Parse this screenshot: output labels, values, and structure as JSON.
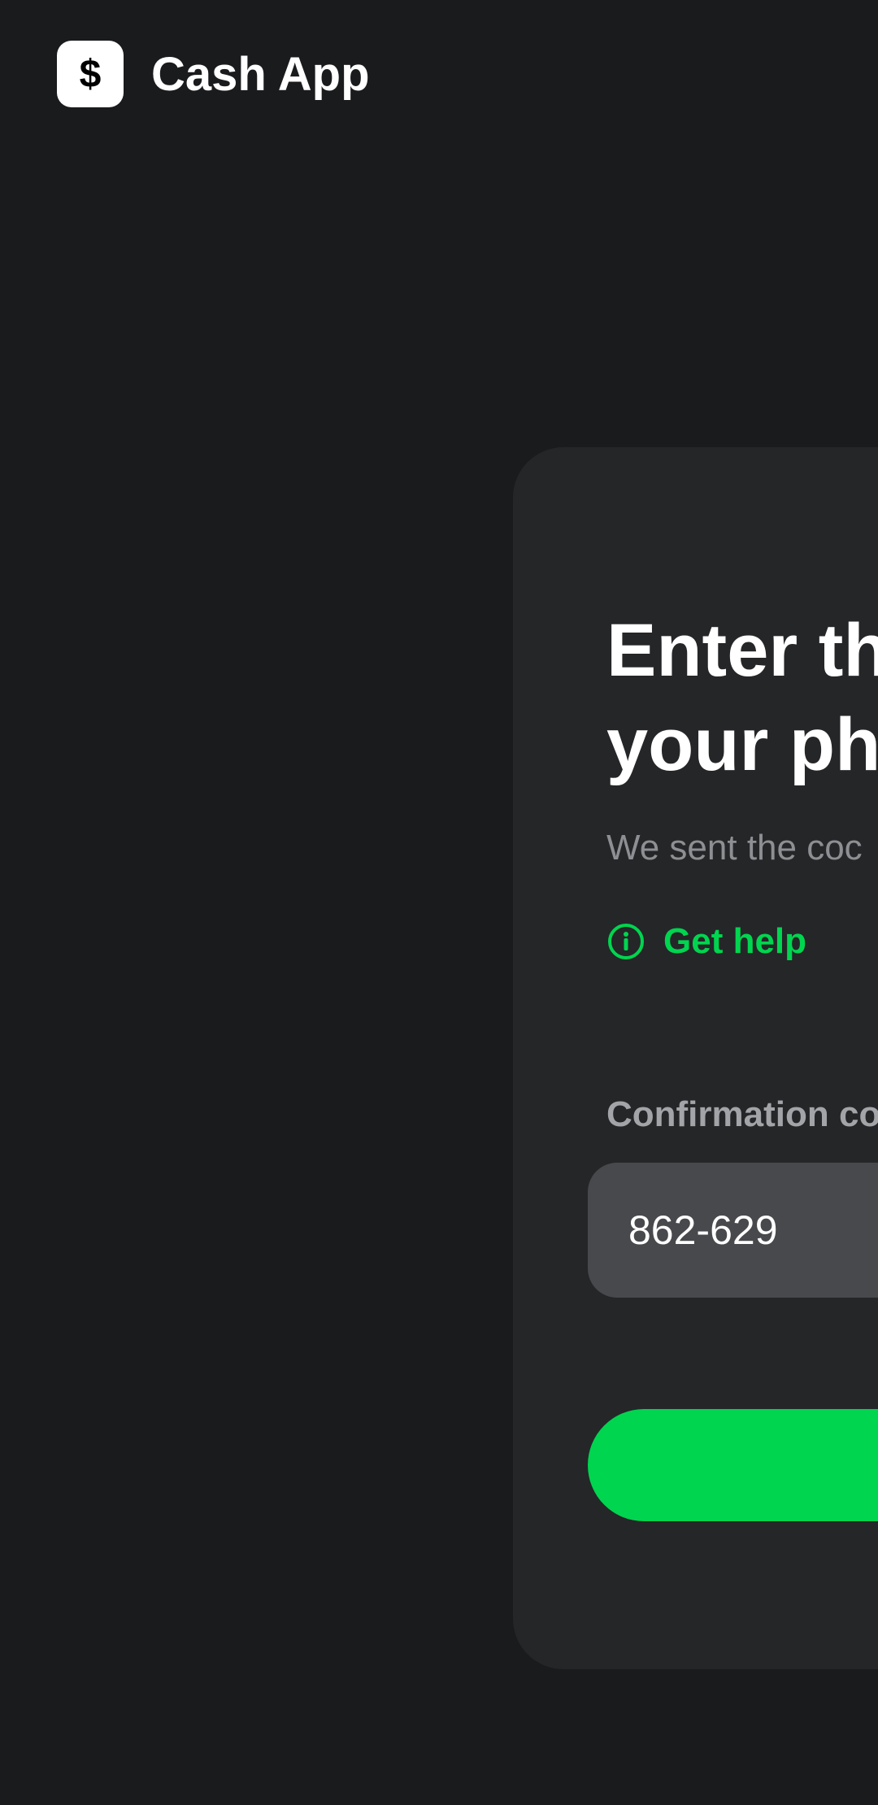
{
  "header": {
    "logo_icon": "dollar-sign-icon",
    "brand_name": "Cash App"
  },
  "card": {
    "title_line1": "Enter th",
    "title_line2": "your ph",
    "subtitle": "We sent the coc",
    "help_icon": "info-circle-icon",
    "help_label": "Get help",
    "field_label": "Confirmation co",
    "field_value": "862-629"
  },
  "colors": {
    "background": "#1a1b1d",
    "card": "#252628",
    "accent_green": "#00d54f",
    "input_bg": "#48494c"
  }
}
